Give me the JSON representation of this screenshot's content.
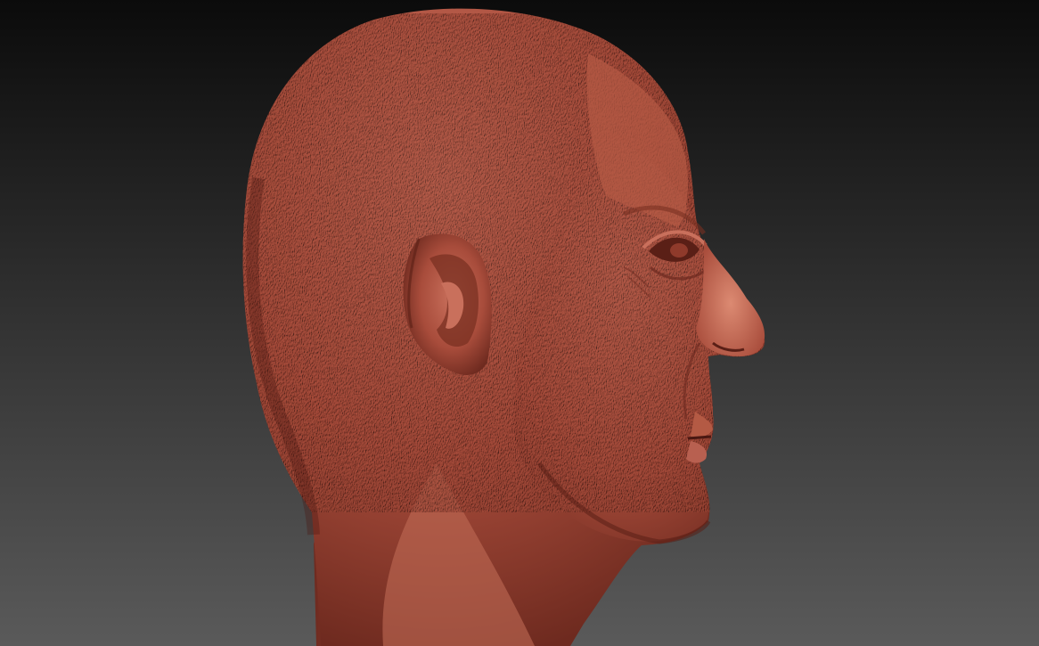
{
  "viewport": {
    "background_top": "#0b0b0b",
    "background_bottom": "#5a5a5a"
  },
  "model": {
    "subject": "sculpted-male-head-profile",
    "material_light": "#c9705c",
    "material_base": "#a84c3b",
    "material_shadow": "#6e2a1f",
    "material_deep": "#4a1812"
  }
}
